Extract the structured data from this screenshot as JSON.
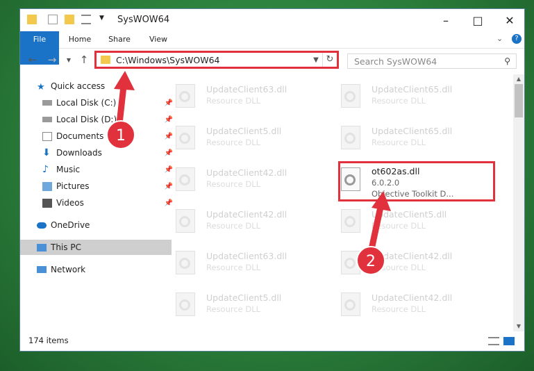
{
  "window": {
    "title": "SysWOW64"
  },
  "ribbon": {
    "tabs": [
      "File",
      "Home",
      "Share",
      "View"
    ]
  },
  "nav": {
    "address": "C:\\Windows\\SysWOW64",
    "search_placeholder": "Search SysWOW64"
  },
  "sidebar": {
    "items": [
      {
        "label": "Quick access",
        "pinned": false
      },
      {
        "label": "Local Disk (C:)",
        "pinned": true
      },
      {
        "label": "Local Disk (D:)",
        "pinned": true
      },
      {
        "label": "Documents",
        "pinned": true
      },
      {
        "label": "Downloads",
        "pinned": true
      },
      {
        "label": "Music",
        "pinned": true
      },
      {
        "label": "Pictures",
        "pinned": true
      },
      {
        "label": "Videos",
        "pinned": true
      },
      {
        "label": "OneDrive",
        "pinned": false
      },
      {
        "label": "This PC",
        "pinned": false
      },
      {
        "label": "Network",
        "pinned": false
      }
    ]
  },
  "files": [
    {
      "name": "UpdateClient63.dll",
      "desc": "Resource DLL"
    },
    {
      "name": "UpdateClient65.dll",
      "desc": "Resource DLL"
    },
    {
      "name": "UpdateClient5.dll",
      "desc": "Resource DLL"
    },
    {
      "name": "UpdateClient65.dll",
      "desc": "Resource DLL"
    },
    {
      "name": "UpdateClient42.dll",
      "desc": "Resource DLL"
    },
    {
      "name": "ot602as.dll",
      "desc": "6.0.2.0",
      "desc2": "Objective Toolkit D..."
    },
    {
      "name": "UpdateClient42.dll",
      "desc": "Resource DLL"
    },
    {
      "name": "UpdateClient5.dll",
      "desc": "Resource DLL"
    },
    {
      "name": "UpdateClient63.dll",
      "desc": "Resource DLL"
    },
    {
      "name": "UpdateClient42.dll",
      "desc": "Resource DLL"
    },
    {
      "name": "UpdateClient5.dll",
      "desc": "Resource DLL"
    },
    {
      "name": "UpdateClient42.dll",
      "desc": "Resource DLL"
    }
  ],
  "status": {
    "items": "174 items"
  },
  "annotations": {
    "step1": "1",
    "step2": "2"
  },
  "colors": {
    "accent": "#1a73c7",
    "highlight": "#e0313c"
  }
}
